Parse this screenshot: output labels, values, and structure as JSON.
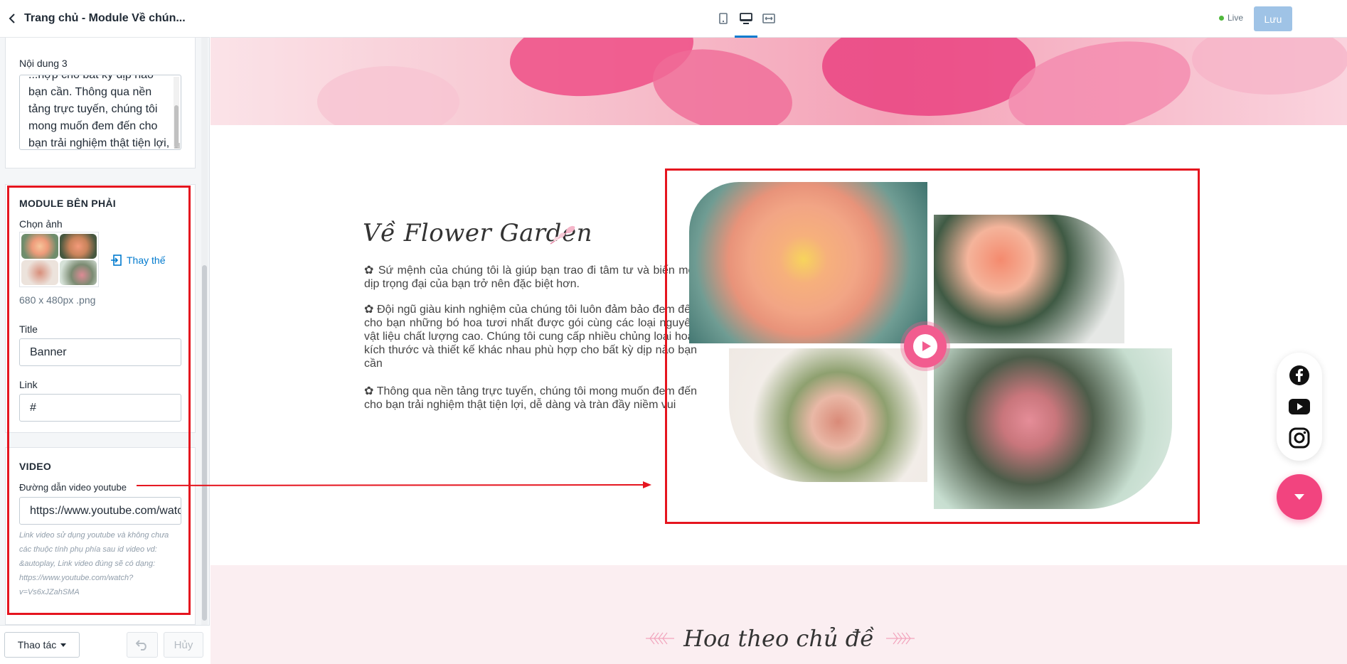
{
  "sidebar": {
    "back_icon": "chevron-left-icon",
    "title": "Trang chủ - Module Về chún...",
    "content3": {
      "label": "Nội dung 3",
      "value": "...hợp cho bất kỳ dịp nào bạn cần. Thông qua nền tảng trực tuyến, chúng tôi mong muốn đem đến cho bạn trải nghiệm thật tiện lợi, dễ dàng và tràn đầy niềm vui"
    },
    "right_module": {
      "heading": "MODULE BÊN PHẢI",
      "choose_image_label": "Chọn ảnh",
      "replace_label": "Thay thế",
      "image_size": "680 x 480px .png",
      "title_label": "Title",
      "title_value": "Banner",
      "link_label": "Link",
      "link_value": "#"
    },
    "video": {
      "heading": "VIDEO",
      "url_label": "Đường dẫn video youtube",
      "url_value": "https://www.youtube.com/watch?v=Vs6xJZahSMA",
      "hint": "Link video sử dụng youtube và không chưa các thuộc tính phụ phía sau id video vd: &autoplay, Link video đúng sẽ có dạng: https://www.youtube.com/watch?v=Vs6xJZahSMA"
    },
    "footer": {
      "actions_label": "Thao tác",
      "undo_icon": "undo-icon",
      "cancel_label": "Hủy"
    }
  },
  "topbar": {
    "devices": [
      "mobile-icon",
      "desktop-icon",
      "fullwidth-icon"
    ],
    "active_device": "desktop",
    "live_label": "Live",
    "save_label": "Lưu"
  },
  "page": {
    "about_title": "Về Flower Garden",
    "paragraphs": [
      "✿ Sứ mệnh của chúng tôi là giúp bạn trao đi tâm tư và biến mọi dịp trọng đại của bạn trở nên đặc biệt hơn.",
      "✿ Đội ngũ giàu kinh nghiệm của chúng tôi luôn đảm bảo đem đến cho bạn những bó hoa tươi nhất được gói cùng các loại nguyên vật liệu chất lượng cao. Chúng tôi cung cấp nhiều chủng loại hoa, kích thước và thiết kế khác nhau phù hợp cho bất kỳ dịp nào bạn cần",
      "✿ Thông qua nền tảng trực tuyến, chúng tôi mong muốn đem đến cho bạn trải nghiệm thật tiện lợi, dễ dàng và tràn đầy niềm vui"
    ],
    "section_title": "Hoa theo chủ đề",
    "social_icons": [
      "facebook-icon",
      "youtube-icon",
      "instagram-icon"
    ],
    "colors": {
      "accent": "#f2447f",
      "highlight": "#e5151f",
      "link": "#007ace"
    }
  }
}
